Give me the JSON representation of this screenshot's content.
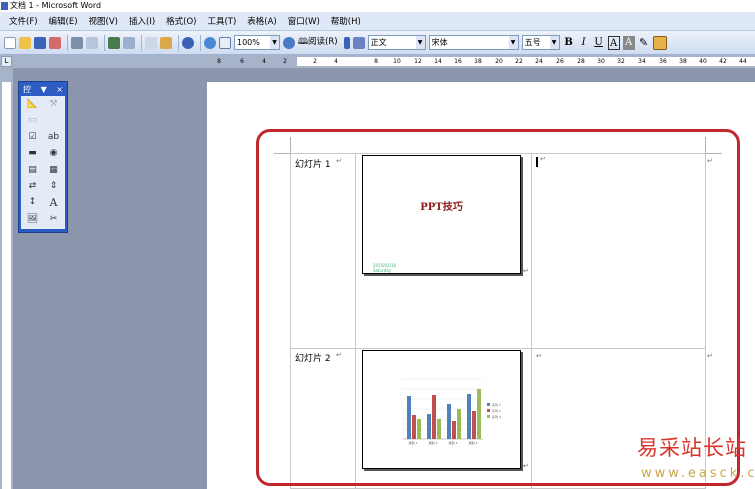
{
  "window": {
    "title": "文档 1 - Microsoft Word"
  },
  "menu": {
    "items": [
      "文件(F)",
      "编辑(E)",
      "视图(V)",
      "插入(I)",
      "格式(O)",
      "工具(T)",
      "表格(A)",
      "窗口(W)",
      "帮助(H)"
    ]
  },
  "toolbar": {
    "zoom": "100%",
    "read_label": "阅读(R)",
    "style": "正文",
    "font": "宋体",
    "size": "五号",
    "bold": "B",
    "italic": "I",
    "underline": "U",
    "char_border": "A",
    "char_shade": "A"
  },
  "ruler": {
    "corner": "L",
    "h_ticks": [
      "8",
      "6",
      "4",
      "2",
      "2",
      "4",
      "8",
      "10",
      "12",
      "14",
      "16",
      "18",
      "20",
      "22",
      "24",
      "26",
      "28",
      "30",
      "32",
      "34",
      "36",
      "38",
      "40",
      "42",
      "44"
    ]
  },
  "control_toolbox": {
    "title": "控",
    "close": "×",
    "text_icon": "A"
  },
  "slides": [
    {
      "label": "幻灯片 1",
      "title": "PPT技巧",
      "subtitle_lines": [
        "2015/01/16",
        "Saturday"
      ]
    },
    {
      "label": "幻灯片 2"
    }
  ],
  "chart_data": {
    "type": "bar",
    "categories": [
      "类别 1",
      "类别 2",
      "类别 3",
      "类别 4"
    ],
    "series": [
      {
        "name": "系列 1",
        "values": [
          4.3,
          2.5,
          3.5,
          4.5
        ],
        "color": "#4f81bd"
      },
      {
        "name": "系列 2",
        "values": [
          2.4,
          4.4,
          1.8,
          2.8
        ],
        "color": "#c0504d"
      },
      {
        "name": "系列 3",
        "values": [
          2.0,
          2.0,
          3.0,
          5.0
        ],
        "color": "#9bbb59"
      }
    ],
    "ylim": [
      0,
      6
    ]
  },
  "watermark": {
    "cn": "易采站长站",
    "url": "www.easck.com"
  },
  "colors": {
    "highlight": "#c0282d",
    "slide_title": "#8b1a1a"
  }
}
